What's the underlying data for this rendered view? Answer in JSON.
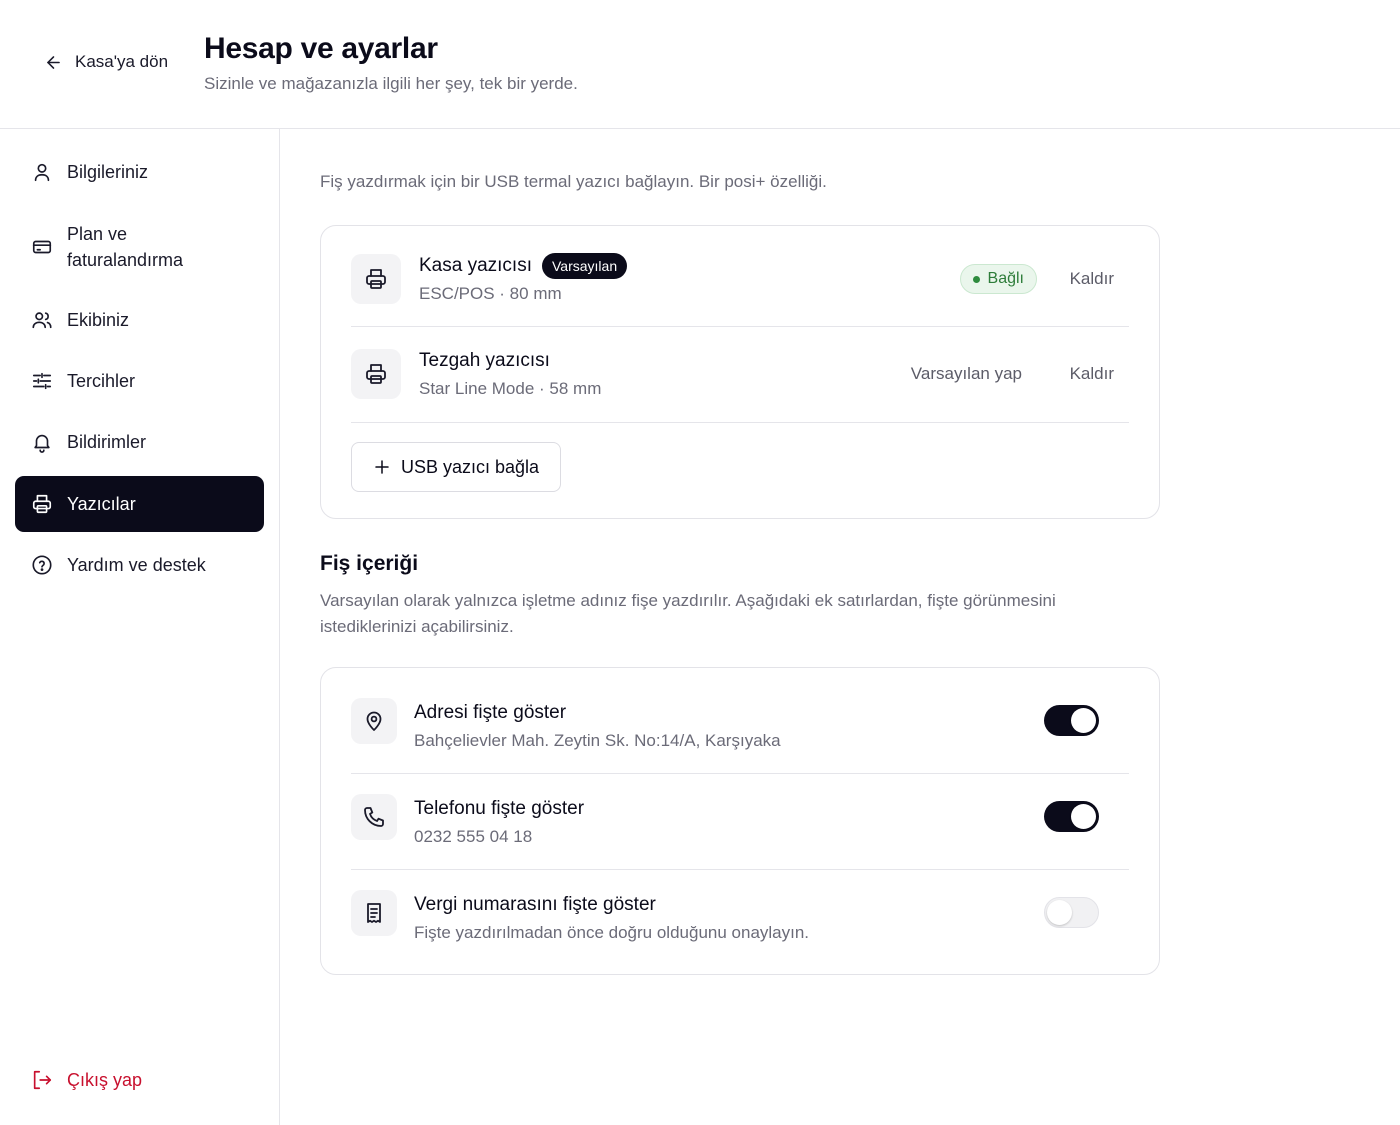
{
  "header": {
    "back_label": "Kasa'ya dön",
    "title": "Hesap ve ayarlar",
    "subtitle": "Sizinle ve mağazanızla ilgili her şey, tek bir yerde."
  },
  "sidebar": {
    "items": [
      {
        "label": "Bilgileriniz",
        "icon": "user-icon"
      },
      {
        "label": "Plan ve faturalandırma",
        "icon": "credit-card-icon"
      },
      {
        "label": "Ekibiniz",
        "icon": "users-icon"
      },
      {
        "label": "Tercihler",
        "icon": "sliders-icon"
      },
      {
        "label": "Bildirimler",
        "icon": "bell-icon"
      },
      {
        "label": "Yazıcılar",
        "icon": "printer-icon",
        "active": true
      },
      {
        "label": "Yardım ve destek",
        "icon": "help-circle-icon"
      }
    ],
    "logout_label": "Çıkış yap"
  },
  "printers": {
    "intro": "Fiş yazdırmak için bir USB termal yazıcı bağlayın. Bir posi+ özelliği.",
    "list": [
      {
        "name": "Kasa yazıcısı",
        "badge": "Varsayılan",
        "details": "ESC/POS · 80 mm",
        "status": "Bağlı",
        "remove_label": "Kaldır"
      },
      {
        "name": "Tezgah yazıcısı",
        "details": "Star Line Mode · 58 mm",
        "make_default_label": "Varsayılan yap",
        "remove_label": "Kaldır"
      }
    ],
    "add_label": "USB yazıcı bağla"
  },
  "receipt": {
    "title": "Fiş içeriği",
    "description": "Varsayılan olarak yalnızca işletme adınız fişe yazdırılır. Aşağıdaki ek satırlardan, fişte görünmesini istediklerinizi açabilirsiniz.",
    "options": [
      {
        "title": "Adresi fişte göster",
        "subtitle": "Bahçelievler Mah. Zeytin Sk. No:14/A, Karşıyaka",
        "enabled": true,
        "icon": "map-pin-icon"
      },
      {
        "title": "Telefonu fişte göster",
        "subtitle": "0232 555 04 18",
        "enabled": true,
        "icon": "phone-icon"
      },
      {
        "title": "Vergi numarasını fişte göster",
        "subtitle": "Fişte yazdırılmadan önce doğru olduğunu onaylayın.",
        "enabled": false,
        "icon": "receipt-icon"
      }
    ]
  },
  "colors": {
    "accent": "#0b0b1a",
    "danger": "#c8102e",
    "success": "#2e7d3a",
    "muted_text": "#6b6b78"
  }
}
